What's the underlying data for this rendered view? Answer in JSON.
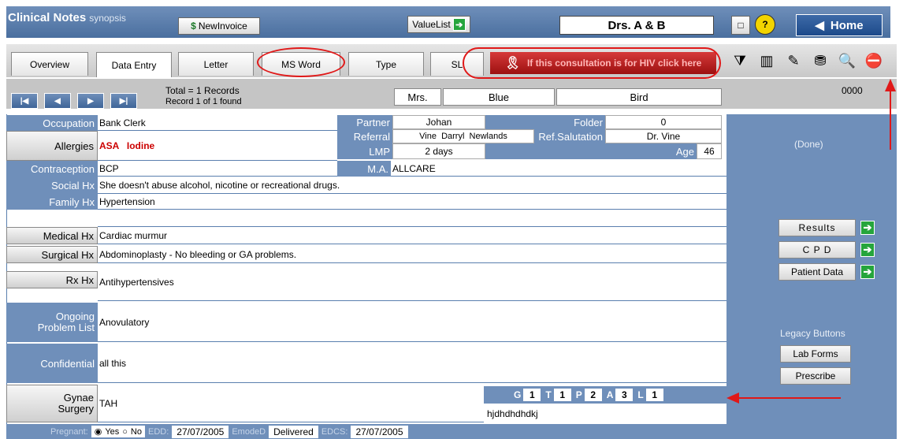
{
  "header": {
    "title": "Clinical Notes",
    "subtitle": "synopsis",
    "new_invoice": "NewInvoice",
    "value_list": "ValueList",
    "doctors": "Drs. A & B",
    "home": "Home"
  },
  "tabs": [
    "Overview",
    "Data Entry",
    "Letter",
    "MS Word",
    "Type",
    "SL"
  ],
  "hiv_banner": "If this consultation is for HIV click here",
  "records": {
    "total": "Total = 1 Records",
    "found": "Record 1 of 1 found",
    "title": "Mrs.",
    "first_name": "Blue",
    "last_name": "Bird",
    "code": "0000"
  },
  "fields": {
    "occupation_label": "Occupation",
    "occupation": "Bank Clerk",
    "allergies_label": "Allergies",
    "allergies": "ASA   Iodine",
    "contraception_label": "Contraception",
    "contraception": "BCP",
    "social_label": "Social Hx",
    "social": "She doesn't abuse alcohol, nicotine or recreational drugs.",
    "family_label": "Family Hx",
    "family": "Hypertension",
    "medical_label": "Medical Hx",
    "medical": "Cardiac murmur",
    "surgical_label": "Surgical Hx",
    "surgical": "Abdominoplasty - No bleeding or GA problems.",
    "rx_label": "Rx Hx",
    "rx": "Antihypertensives",
    "ongoing_label_1": "Ongoing",
    "ongoing_label_2": "Problem List",
    "ongoing": "Anovulatory",
    "confidential_label": "Confidential",
    "confidential": "all this",
    "gynae_label_1": "Gynae",
    "gynae_label_2": "Surgery",
    "gynae": "TAH",
    "notes": "hjdhdhdhdkj"
  },
  "middle": {
    "partner_label": "Partner",
    "partner": "Johan",
    "folder_label": "Folder",
    "folder": "0",
    "referral_label": "Referral",
    "referral": "Vine  Darryl  Newlands",
    "ref_sal_label": "Ref.Salutation",
    "ref_sal": "Dr. Vine",
    "lmp_label": "LMP",
    "lmp": "2 days",
    "age_label": "Age",
    "age": "46",
    "ma_label": "M.A.",
    "ma": "ALLCARE"
  },
  "gtpal": {
    "g_label": "G",
    "g": "1",
    "t_label": "T",
    "t": "1",
    "p_label": "P",
    "p": "2",
    "a_label": "A",
    "a": "3",
    "l_label": "L",
    "l": "1"
  },
  "right_panel": {
    "done": "(Done)",
    "results": "Results",
    "cpd": "C P D",
    "patient_data": "Patient Data",
    "legacy": "Legacy Buttons",
    "lab_forms": "Lab Forms",
    "prescribe": "Prescribe"
  },
  "bottom": {
    "pregnant_label": "Pregnant:",
    "yes": "Yes",
    "no": "No",
    "edd_label": "EDD:",
    "edd": "27/07/2005",
    "emode_label": "EmodeD",
    "emode": "Delivered",
    "edcs_label": "EDCS:",
    "edcs": "27/07/2005"
  },
  "colors": {
    "panel_blue": "#6f8fba",
    "annotation_red": "#e01818",
    "allergy_red": "#cc0000"
  }
}
